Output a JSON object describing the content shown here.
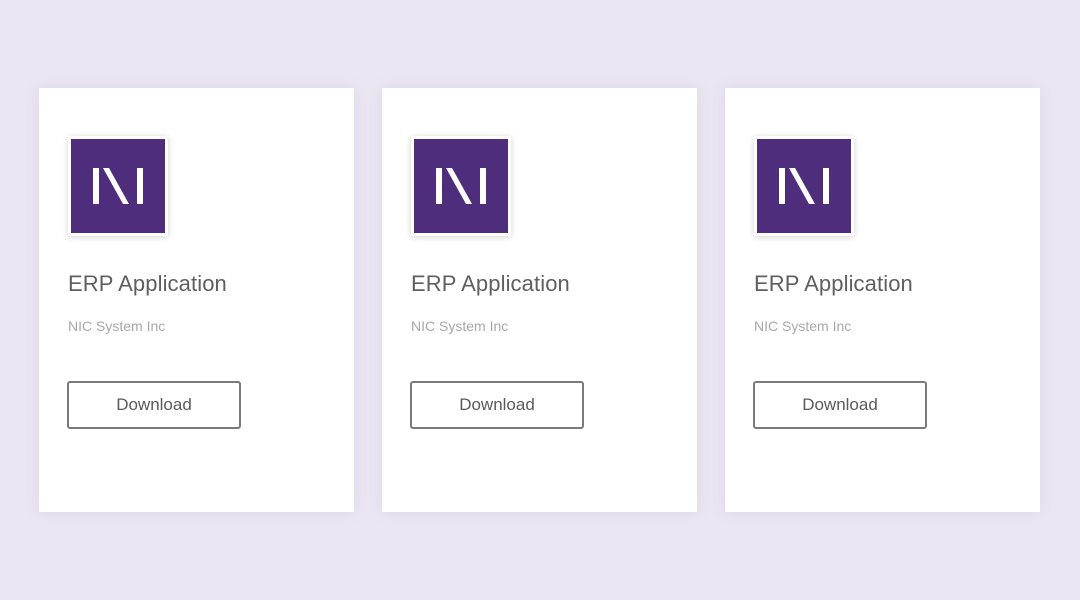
{
  "theme": {
    "background": "#ebe6f2",
    "card_background": "#ffffff",
    "logo_color": "#4e2d7c"
  },
  "cards": [
    {
      "logo_icon": "nic-logo-icon",
      "title": "ERP Application",
      "publisher": "NIC System Inc",
      "download_label": "Download"
    },
    {
      "logo_icon": "nic-logo-icon",
      "title": "ERP Application",
      "publisher": "NIC System Inc",
      "download_label": "Download"
    },
    {
      "logo_icon": "nic-logo-icon",
      "title": "ERP Application",
      "publisher": "NIC System Inc",
      "download_label": "Download"
    }
  ]
}
